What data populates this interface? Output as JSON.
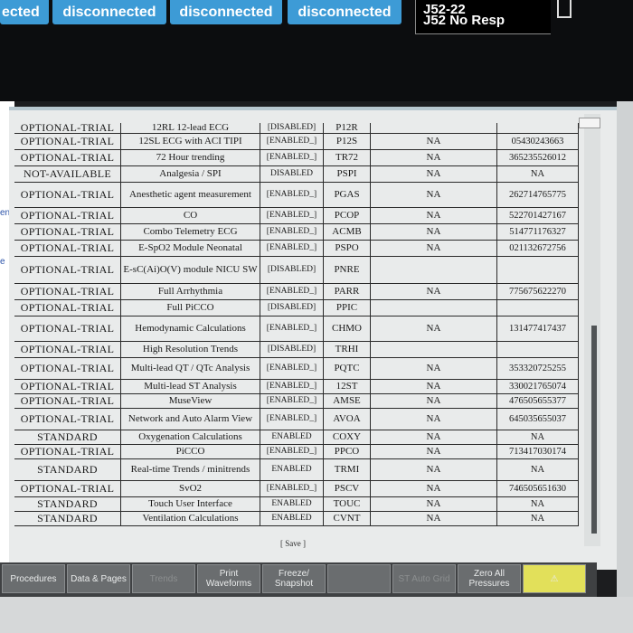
{
  "header": {
    "tabs": [
      {
        "label": "ected"
      },
      {
        "label": "disconnected"
      },
      {
        "label": "disconnected"
      },
      {
        "label": "disconnected"
      }
    ],
    "status": {
      "line1": "J52-22",
      "line2": "J52 No Resp"
    }
  },
  "left_gutter": {
    "label1": "ent",
    "label2": "e"
  },
  "options_table": {
    "top_partial": {
      "status": "OPTIONAL-TRIAL",
      "description": "12RL 12-lead ECG",
      "state": "[DISABLED]",
      "code": "P12R"
    },
    "rows": [
      {
        "status": "OPTIONAL-TRIAL",
        "description": "12SL ECG with ACI TIPI",
        "state": "[ENABLED_]",
        "code": "P12S",
        "col5": "NA",
        "col6": "05430243663"
      },
      {
        "status": "OPTIONAL-TRIAL",
        "description": "72 Hour trending",
        "state": "[ENABLED_]",
        "code": "TR72",
        "col5": "NA",
        "col6": "365235526012"
      },
      {
        "status": "NOT-AVAILABLE",
        "description": "Analgesia / SPI",
        "state": "DISABLED",
        "code": "PSPI",
        "col5": "NA",
        "col6": "NA"
      },
      {
        "status": "OPTIONAL-TRIAL",
        "description": "Anesthetic agent measurement",
        "state": "[ENABLED_]",
        "code": "PGAS",
        "col5": "NA",
        "col6": "262714765775"
      },
      {
        "status": "OPTIONAL-TRIAL",
        "description": "CO",
        "state": "[ENABLED_]",
        "code": "PCOP",
        "col5": "NA",
        "col6": "522701427167"
      },
      {
        "status": "OPTIONAL-TRIAL",
        "description": "Combo Telemetry ECG",
        "state": "[ENABLED_]",
        "code": "ACMB",
        "col5": "NA",
        "col6": "514771176327"
      },
      {
        "status": "OPTIONAL-TRIAL",
        "description": "E-SpO2 Module Neonatal",
        "state": "[ENABLED_]",
        "code": "PSPO",
        "col5": "NA",
        "col6": "021132672756"
      },
      {
        "status": "OPTIONAL-TRIAL",
        "description": "E-sC(Ai)O(V) module NICU SW",
        "state": "[DISABLED]",
        "code": "PNRE",
        "col5": "",
        "col6": ""
      },
      {
        "status": "OPTIONAL-TRIAL",
        "description": "Full Arrhythmia",
        "state": "[ENABLED_]",
        "code": "PARR",
        "col5": "NA",
        "col6": "775675622270"
      },
      {
        "status": "OPTIONAL-TRIAL",
        "description": "Full PiCCO",
        "state": "[DISABLED]",
        "code": "PPIC",
        "col5": "",
        "col6": ""
      },
      {
        "status": "OPTIONAL-TRIAL",
        "description": "Hemodynamic Calculations",
        "state": "[ENABLED_]",
        "code": "CHMO",
        "col5": "NA",
        "col6": "131477417437"
      },
      {
        "status": "OPTIONAL-TRIAL",
        "description": "High Resolution Trends",
        "state": "[DISABLED]",
        "code": "TRHI",
        "col5": "",
        "col6": ""
      },
      {
        "status": "OPTIONAL-TRIAL",
        "description": "Multi-lead QT / QTc Analysis",
        "state": "[ENABLED_]",
        "code": "PQTC",
        "col5": "NA",
        "col6": "353320725255"
      },
      {
        "status": "OPTIONAL-TRIAL",
        "description": "Multi-lead ST Analysis",
        "state": "[ENABLED_]",
        "code": "12ST",
        "col5": "NA",
        "col6": "330021765074"
      },
      {
        "status": "OPTIONAL-TRIAL",
        "description": "MuseView",
        "state": "[ENABLED_]",
        "code": "AMSE",
        "col5": "NA",
        "col6": "476505655377"
      },
      {
        "status": "OPTIONAL-TRIAL",
        "description": "Network and Auto Alarm View",
        "state": "[ENABLED_]",
        "code": "AVOA",
        "col5": "NA",
        "col6": "645035655037"
      },
      {
        "status": "STANDARD",
        "description": "Oxygenation Calculations",
        "state": "ENABLED",
        "code": "COXY",
        "col5": "NA",
        "col6": "NA"
      },
      {
        "status": "OPTIONAL-TRIAL",
        "description": "PiCCO",
        "state": "[ENABLED_]",
        "code": "PPCO",
        "col5": "NA",
        "col6": "713417030174"
      },
      {
        "status": "STANDARD",
        "description": "Real-time Trends / minitrends",
        "state": "ENABLED",
        "code": "TRMI",
        "col5": "NA",
        "col6": "NA"
      },
      {
        "status": "OPTIONAL-TRIAL",
        "description": "SvO2",
        "state": "[ENABLED_]",
        "code": "PSCV",
        "col5": "NA",
        "col6": "746505651630"
      },
      {
        "status": "STANDARD",
        "description": "Touch User Interface",
        "state": "ENABLED",
        "code": "TOUC",
        "col5": "NA",
        "col6": "NA"
      },
      {
        "status": "STANDARD",
        "description": "Ventilation Calculations",
        "state": "ENABLED",
        "code": "CVNT",
        "col5": "NA",
        "col6": "NA"
      }
    ]
  },
  "save_link": "[ Save ]",
  "buttons": [
    {
      "label": "Procedures"
    },
    {
      "label": "Data & Pages"
    },
    {
      "label": "Trends"
    },
    {
      "label": "Print Waveforms"
    },
    {
      "label": "Freeze/ Snapshot"
    },
    {
      "label": ""
    },
    {
      "label": "ST Auto Grid"
    },
    {
      "label": "Zero All Pressures"
    },
    {
      "label": "⚠"
    }
  ],
  "colors": {
    "tab_blue": "#3d9bd6",
    "alarm_yellow": "#e2e05a"
  }
}
